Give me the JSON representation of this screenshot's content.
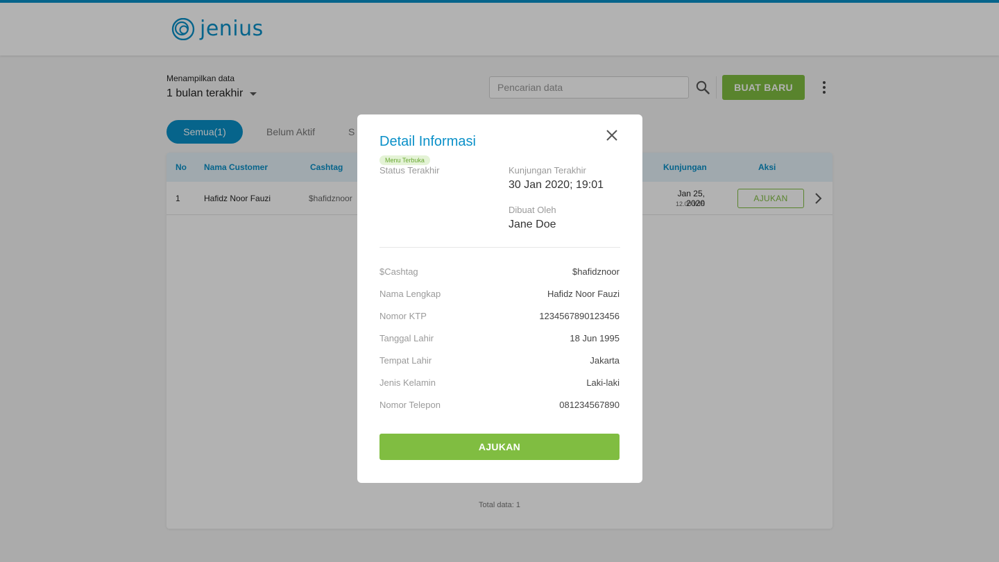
{
  "header": {
    "logo_text": "jenius"
  },
  "filter": {
    "label": "Menampilkan data",
    "value": "1 bulan terakhir"
  },
  "search": {
    "placeholder": "Pencarian data"
  },
  "toolbar": {
    "new_label": "BUAT BARU"
  },
  "tabs": [
    {
      "label": "Semua(1)",
      "active": true
    },
    {
      "label": "Belum Aktif",
      "active": false
    },
    {
      "label": "S",
      "active": false
    }
  ],
  "table": {
    "columns": [
      "No",
      "Nama Customer",
      "Cashtag",
      "Kunjungan",
      "Aksi"
    ],
    "rows": [
      {
        "no": "1",
        "name": "Hafidz Noor Fauzi",
        "cashtag": "$hafidznoor",
        "visit_date": "Jan 25, 2020",
        "visit_time": "12.00 WIB",
        "action": "AJUKAN"
      }
    ],
    "total": "Total data: 1"
  },
  "modal": {
    "title": "Detail Informasi",
    "badge": "Menu Terbuka",
    "status_label": "Status Terakhir",
    "last_visit_label": "Kunjungan Terakhir",
    "last_visit_value": "30 Jan 2020; 19:01",
    "created_by_label": "Dibuat Oleh",
    "created_by_value": "Jane Doe",
    "details": [
      {
        "label": "$Cashtag",
        "value": "$hafidznoor"
      },
      {
        "label": "Nama Lengkap",
        "value": "Hafidz Noor Fauzi"
      },
      {
        "label": "Nomor KTP",
        "value": "1234567890123456"
      },
      {
        "label": "Tanggal Lahir",
        "value": "18 Jun 1995"
      },
      {
        "label": "Tempat Lahir",
        "value": "Jakarta"
      },
      {
        "label": "Jenis Kelamin",
        "value": "Laki-laki"
      },
      {
        "label": "Nomor Telepon",
        "value": "081234567890"
      }
    ],
    "submit_label": "AJUKAN"
  },
  "colors": {
    "brand_blue": "#0a90c8",
    "accent_green": "#80bd41",
    "header_row_bg": "#e6f2f9"
  },
  "icons": {
    "logo": "jenius-logo-icon",
    "search": "search-icon",
    "more": "more-vert-icon",
    "caret": "caret-down-icon",
    "close": "close-icon",
    "row_chevron": "chevron-right-icon"
  }
}
